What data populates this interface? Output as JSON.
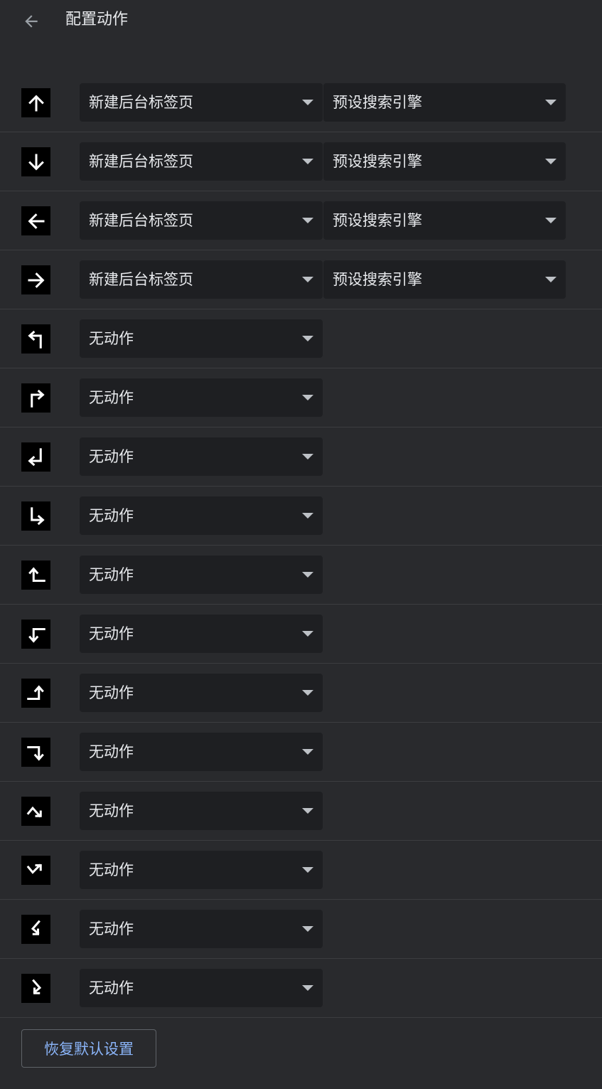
{
  "header": {
    "back_icon": "arrow-left-icon",
    "title": "配置动作"
  },
  "gestures": [
    {
      "icon": "gesture-up-icon",
      "action": "新建后台标签页",
      "option": "预设搜索引擎"
    },
    {
      "icon": "gesture-down-icon",
      "action": "新建后台标签页",
      "option": "预设搜索引擎"
    },
    {
      "icon": "gesture-left-icon",
      "action": "新建后台标签页",
      "option": "预设搜索引擎"
    },
    {
      "icon": "gesture-right-icon",
      "action": "新建后台标签页",
      "option": "预设搜索引擎"
    },
    {
      "icon": "gesture-up-left-icon",
      "action": "无动作"
    },
    {
      "icon": "gesture-up-right-icon",
      "action": "无动作"
    },
    {
      "icon": "gesture-down-left-icon",
      "action": "无动作"
    },
    {
      "icon": "gesture-down-right-icon",
      "action": "无动作"
    },
    {
      "icon": "gesture-left-up-icon",
      "action": "无动作"
    },
    {
      "icon": "gesture-left-down-icon",
      "action": "无动作"
    },
    {
      "icon": "gesture-right-up-icon",
      "action": "无动作"
    },
    {
      "icon": "gesture-right-down-icon",
      "action": "无动作"
    },
    {
      "icon": "gesture-up-down-right-icon",
      "action": "无动作"
    },
    {
      "icon": "gesture-down-up-right-icon",
      "action": "无动作"
    },
    {
      "icon": "gesture-left-zigzag-icon",
      "action": "无动作"
    },
    {
      "icon": "gesture-right-zigzag-icon",
      "action": "无动作"
    }
  ],
  "reset_button": "恢复默认设置",
  "colors": {
    "background": "#292a2d",
    "select_background": "#1e1f22",
    "accent": "#8ab4f8"
  }
}
